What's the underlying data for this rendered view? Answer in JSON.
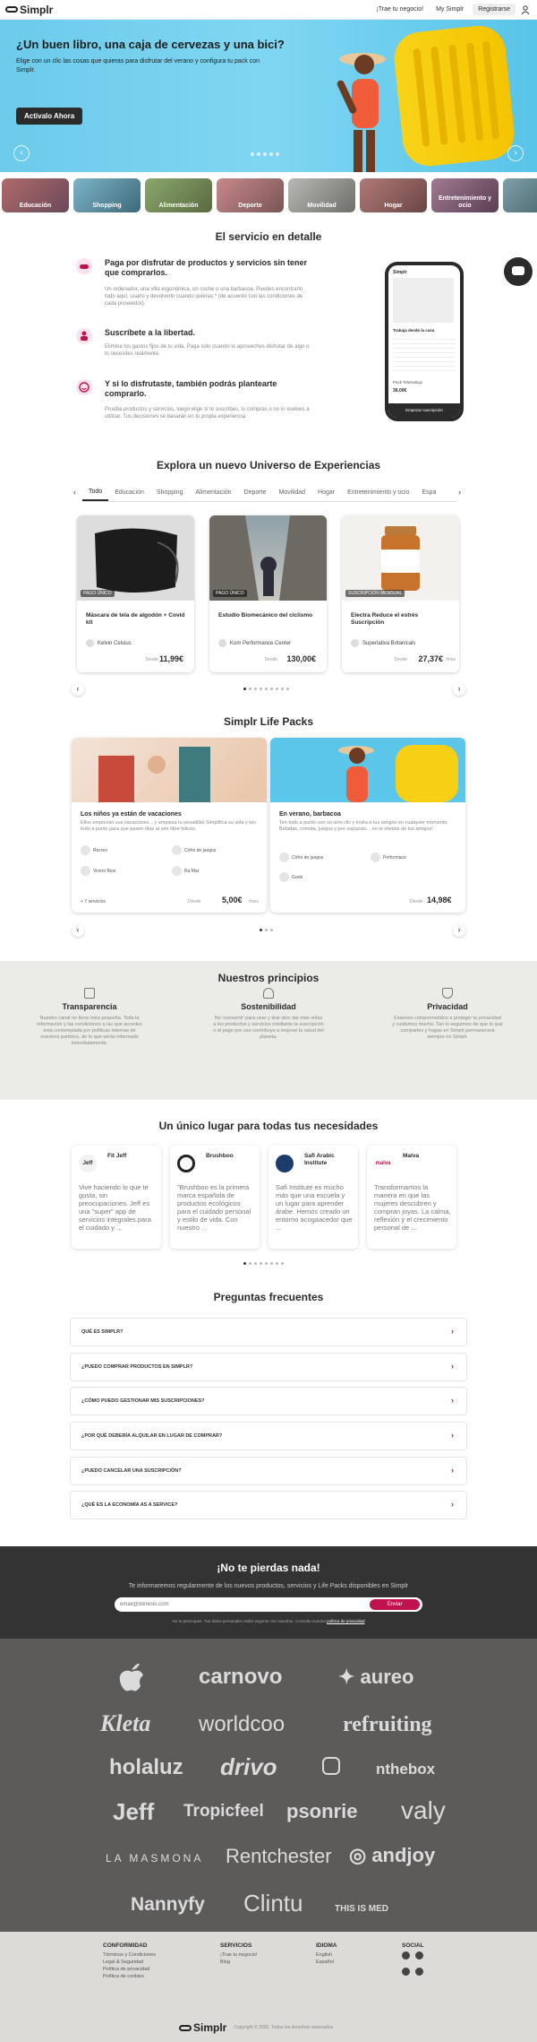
{
  "header": {
    "brand": "Simplr",
    "nav": [
      "¡Trae tu negocio!",
      "My Simplr"
    ],
    "register": "Registrarse"
  },
  "hero": {
    "title": "¿Un buen libro, una caja de cervezas y una bici?",
    "subtitle": "Elige con un clic las cosas que quieras para disfrutar del verano y configura tu pack con Simplr.",
    "cta": "Activalo Ahora"
  },
  "categories": [
    "Educación",
    "Shopping",
    "Alimentación",
    "Deporte",
    "Movilidad",
    "Hogar",
    "Entretenimiento y ocio"
  ],
  "service": {
    "title": "El servicio en detalle",
    "items": [
      {
        "title": "Paga por disfrutar de productos y servicios sin tener que comprarlos.",
        "text": "Un ordenador, una villa ergonómica, un coche o una barbacoa. Puedes encontrarlo todo aquí, usarlo y devolverlo cuando quieras * (de acuerdo con las condiciones de cada proveedor)."
      },
      {
        "title": "Suscríbete a la libertad.",
        "text": "Elimina los gastos fijos de tu vida. Paga solo cuando lo aproveches disfrutar de algo o lo necesites realmente."
      },
      {
        "title": "Y si lo disfrutaste, también podrás plantearte comprarlo.",
        "text": "Prueba productos y servicios, luego elige si te suscribes, lo compras o no lo vuelves a utilizar. Tus decisiones se basarán en tu propia experiencia."
      }
    ],
    "phone": {
      "heading": "Trabaja desde la casa",
      "pack": "Pack Teletrabajo",
      "price": "36,00€",
      "cta": "Empezar suscripción"
    }
  },
  "explore": {
    "title": "Explora un nuevo Universo de Experiencias",
    "tabs": [
      "Todo",
      "Educación",
      "Shopping",
      "Alimentación",
      "Deporte",
      "Movilidad",
      "Hogar",
      "Entretenimiento y ocio",
      "Espa"
    ],
    "cards": [
      {
        "badge": "PAGO ÚNICO",
        "name": "Máscara de tela de algodón + Covid kit",
        "provider": "Kelvin Celsius",
        "from": "Desde",
        "price": "11,99€",
        "per": ""
      },
      {
        "badge": "PAGO ÚNICO",
        "name": "Estudio Biomecánico del ciclismo",
        "provider": "Kom Performance Center",
        "from": "Desde",
        "price": "130,00€",
        "per": ""
      },
      {
        "badge": "SUSCRIPCIÓN MENSUAL",
        "name": "Electra Reduce el estrés Suscripción",
        "provider": "Superlativa Botanicals",
        "from": "Desde",
        "price": "27,37€",
        "per": "/mes"
      }
    ]
  },
  "lifepacks": {
    "title": "Simplr Life Packs",
    "cards": [
      {
        "title": "Los niños ya están de vacaciones",
        "text": "Ellos empiezan sus vacaciones... y empieza tu pesadilla! Simplifica su vida y ten todo a punto para que pasen días al aire libre felices.",
        "items": [
          "Recreo",
          "Cofre de juegos",
          "Vivero Bosi",
          "Ra Mar"
        ],
        "more": "+ 7 servicios",
        "from": "Desde",
        "price": "5,00€",
        "per": "/mes"
      },
      {
        "title": "En verano, barbacoa",
        "text": "Ten todo a punto con un solo clic y invita a tus amigos en cualquier momento. Bebidas, comida, juegos y por supuesto... no te olvides de tus amigos!",
        "items": [
          "Cofre de juegos",
          "Performace",
          "Goob"
        ],
        "more": "",
        "from": "Desde",
        "price": "14,98€",
        "per": ""
      }
    ]
  },
  "principles": {
    "title": "Nuestros principios",
    "cols": [
      {
        "title": "Transparencia",
        "text": "Nuestro canal no tiene letra pequeña. Toda la información y las condiciones a las que accedes está contemplada por políticas internas de nuestros partners, de lo que serás informado inmediatamente."
      },
      {
        "title": "Sostenibilidad",
        "text": "No 'consumir' para usar y tirar sino dar más vidas a los productos y servicios mediante la suscripción o el pago por uso contribuye a mejorar la salud del planeta."
      },
      {
        "title": "Privacidad",
        "text": "Estamos comprometidos a proteger tu privacidad y cuidamos mucho. Tan lo seguimos de que lo que compartes y hagas en Simplr permanecerá siempre en Simplr."
      }
    ]
  },
  "partners": {
    "title": "Un único lugar para todas tus necesidades",
    "cards": [
      {
        "logo": "Jeff",
        "name": "Fit Jeff",
        "text": "Vive haciendo lo que te gusta, sin preocupaciones. Jeff es una \"super\" app de servicios integrales para el cuidado y ..."
      },
      {
        "logo": "",
        "name": "Brushboo",
        "text": "\"Brushboo es la primera marca española de productos ecológicos para el cuidado personal y estilo de vida. Con nuestro ..."
      },
      {
        "logo": "",
        "name": "Safi Arabic Institute",
        "text": "Safi Institute es mucho más que una escuela y un lugar para aprender árabe. Hemos creado un entorno acogaacedor que ..."
      },
      {
        "logo": "malva",
        "name": "Malva",
        "text": "Transformamos la manera en que las mujeres descubren y compran joyas. La calma, reflexión y el crecimiento personal de ..."
      }
    ]
  },
  "faq": {
    "title": "Preguntas frecuentes",
    "items": [
      "QUÉ ES SIMPLR?",
      "¿PUEDO COMPRAR PRODUCTOS EN SIMPLR?",
      "¿CÓMO PUEDO GESTIONAR MIS SUSCRIPCIONES?",
      "¿POR QUÉ DEBERÍA ALQUILAR EN LUGAR DE COMPRAR?",
      "¿PUEDO CANCELAR UNA SUSCRIPCIÓN?",
      "¿QUÉ ES LA ECONOMÍA AS A SERVICE?"
    ]
  },
  "newsletter": {
    "title": "¡No te pierdas nada!",
    "subtitle": "Te informaremos regularmente de los nuevos productos, servicios y Life Packs disponibles en Simplr",
    "placeholder": "email@dominio.com",
    "button": "Enviar",
    "privacy": "No te preocupes. Tus datos personales están seguros con nosotros. Consulta nuestra",
    "privacy_link": "política de privacidad"
  },
  "brands": [
    "carnovo",
    "aureo",
    "Kleta",
    "worldcoo",
    "refruiting",
    "holaluz",
    "drivo",
    "nthebox",
    "Jeff",
    "Tropicfeel",
    "psonrie",
    "valy",
    "LA MASMONA",
    "Rentchester",
    "andjoy",
    "Nannyfy",
    "Clintu",
    "THIS IS MED"
  ],
  "footer": {
    "cols": [
      {
        "title": "CONFORMIDAD",
        "links": [
          "Términos y Condiciones",
          "Legal & Seguridad",
          "Política de privacidad",
          "Política de cookies"
        ]
      },
      {
        "title": "SERVICIOS",
        "links": [
          "¡Trae tu negocio!",
          "Blog"
        ]
      },
      {
        "title": "IDIOMA",
        "links": [
          "English",
          "Español"
        ]
      },
      {
        "title": "SOCIAL",
        "links": []
      }
    ],
    "copyright": "Copyright © 2020. Todos los derechos reservados"
  },
  "colors": {
    "accent": "#c0124f",
    "dark": "#2b2b2b",
    "hero": "#7fd6f2",
    "wall": "#5d5b5a"
  }
}
